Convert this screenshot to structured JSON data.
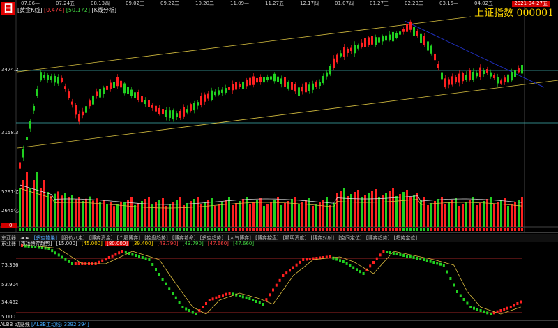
{
  "header": {
    "day_badge": "日",
    "chart_label": "[黄金K线]",
    "value_1": "[0.474]",
    "value_2": "[50.172]",
    "view_label": "[K线分析]",
    "index_title": "上证指数  000001",
    "date_badge": "2021-04-27五"
  },
  "x_dates": [
    "07.06—",
    "07.24五",
    "08.13四",
    "09.02三",
    "09.22二",
    "10.20二",
    "11.09—",
    "11.27五",
    "12.17四",
    "01.07四",
    "01.27三",
    "02.23二",
    "03.15—",
    "04.02五"
  ],
  "price_axis": [
    "3474.2",
    "3158.3"
  ],
  "volume_axis": [
    "5291亿",
    "2645亿",
    "0"
  ],
  "tabs": {
    "left": "东亚器",
    "arrows": "◄ ►",
    "items": [
      "[多空能量]",
      "[股价八走]",
      "[博弈资金]",
      "[个股博弈]",
      "[控盘趋势]",
      "[博弈着命]",
      "[多空趋势]",
      "[人气博弈]",
      "[博弈控盘]",
      "[精明资度]",
      "[博弈对射]",
      "[空间定位]",
      "[博弈趋势]",
      "[趋势定位]"
    ]
  },
  "oscillator": {
    "name": "东亚器",
    "subname": "[市场博弈趋势]",
    "values": [
      "[15.000]",
      "[45.000]",
      "[80.000]",
      "[39.400]",
      "[43.790]",
      "[43.790]",
      "[47.660]",
      "[47.660]"
    ],
    "axis": [
      "73.356",
      "53.904",
      "34.452",
      "5.000"
    ]
  },
  "bottom": {
    "label": "ALBB_动感线",
    "value": "[ALBB主动线: 3292.394]"
  },
  "colors": {
    "up": "#ff2020",
    "down": "#20d020",
    "trend_line": "#d8c040",
    "h_line": "#40b0b0",
    "down_trend": "#2030c0",
    "index_title": "#ffd700"
  }
}
